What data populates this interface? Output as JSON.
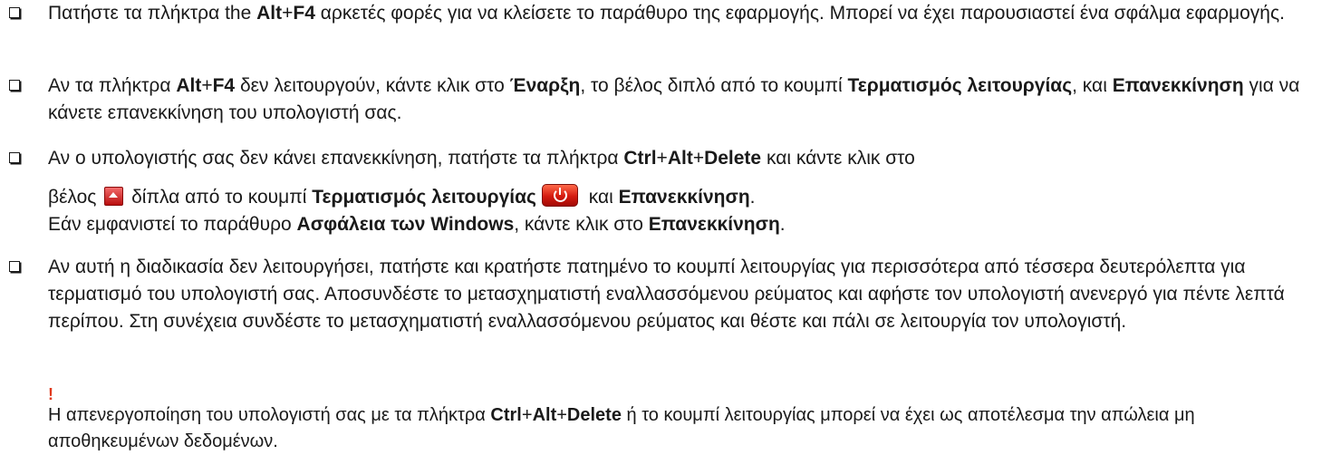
{
  "items": [
    {
      "line1": [
        {
          "t": "Πατήστε τα πλήκτρα the ",
          "b": false
        },
        {
          "t": "Alt",
          "b": true
        },
        {
          "t": "+",
          "b": false
        },
        {
          "t": "F4",
          "b": true
        },
        {
          "t": " αρκετές φορές για να κλείσετε το παράθυρο της εφαρμογής. Μπορεί να έχει παρουσιαστεί ένα σφάλμα εφαρμογής.",
          "b": false
        }
      ]
    },
    {
      "line1": [
        {
          "t": "Αν τα πλήκτρα ",
          "b": false
        },
        {
          "t": "Alt",
          "b": true
        },
        {
          "t": "+",
          "b": false
        },
        {
          "t": "F4",
          "b": true
        },
        {
          "t": " δεν λειτουργούν, κάντε κλικ στο ",
          "b": false
        },
        {
          "t": "Έναρξη",
          "b": true
        },
        {
          "t": ", το βέλος διπλό από το κουμπί ",
          "b": false
        },
        {
          "t": "Τερματισμός λειτουργίας",
          "b": true
        },
        {
          "t": ", και ",
          "b": false
        },
        {
          "t": "Επανεκκίνηση",
          "b": true
        },
        {
          "t": " για να κάνετε επανεκκίνηση του υπολογιστή σας.",
          "b": false
        }
      ]
    }
  ],
  "item3": {
    "p1_a": "Αν ο υπολογιστής σας δεν κάνει επανεκκίνηση, πατήστε τα πλήκτρα ",
    "ctrl": "Ctrl",
    "plus1": "+",
    "alt": "Alt",
    "plus2": "+",
    "del": "Delete",
    "p1_b": " και κάντε κλικ στο",
    "p2_a": "βέλος ",
    "p2_b": " δίπλα από το κουμπί ",
    "shutdown": "Τερματισμός λειτουργίας",
    "p2_c": " και ",
    "restart1": "Επανεκκίνηση",
    "p2_d": ".",
    "p3_a": "Εάν εμφανιστεί το παράθυρο ",
    "security": "Ασφάλεια των Windows",
    "p3_b": ", κάντε κλικ στο ",
    "restart2": "Επανεκκίνηση",
    "p3_c": "."
  },
  "item4": {
    "text": "Αν αυτή η διαδικασία δεν λειτουργήσει, πατήστε και κρατήστε πατημένο το κουμπί λειτουργίας για περισσότερα από τέσσερα δευτερόλεπτα για τερματισμό του υπολογιστή σας. Αποσυνδέστε το μετασχηματιστή εναλλασσόμενου ρεύματος και αφήστε τον υπολογιστή ανενεργό για πέντε λεπτά περίπου. Στη συνέχεια συνδέστε το μετασχηματιστή εναλλασσόμενου ρεύματος και θέστε και πάλι σε λειτουργία τον υπολογιστή."
  },
  "warning": {
    "mark": "!",
    "a": "Η απενεργοποίηση του υπολογιστή σας με τα πλήκτρα ",
    "ctrl": "Ctrl",
    "plus1": "+",
    "alt": "Alt",
    "plus2": "+",
    "del": "Delete",
    "b": " ή το κουμπί λειτουργίας μπορεί να έχει ως αποτέλεσμα την απώλεια μη αποθηκευμένων δεδομένων."
  },
  "icons": {
    "checkbox": "checkbox-icon",
    "arrow": "arrow-up-icon",
    "shutdown": "shutdown-button-icon"
  },
  "colors": {
    "text": "#1a1a1a",
    "warning": "#e03a1e",
    "button_red": "#d41b10"
  }
}
